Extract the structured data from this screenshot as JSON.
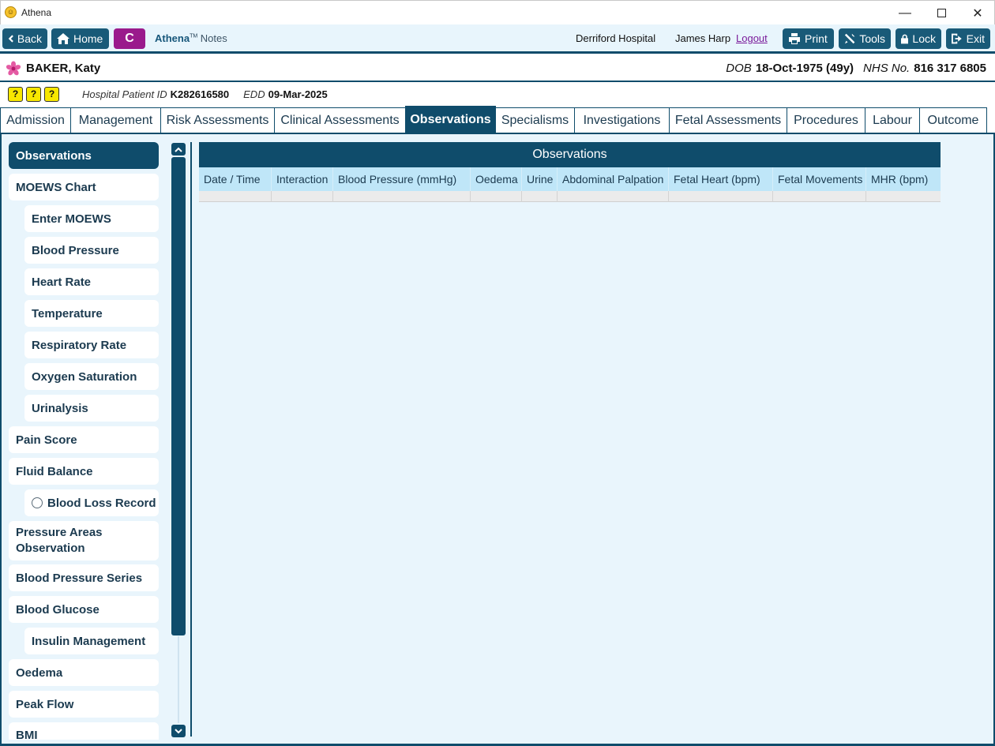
{
  "window": {
    "title": "Athena",
    "minimize": "—",
    "close": "✕"
  },
  "toolbar": {
    "back_label": "Back",
    "home_label": "Home",
    "c_label": "C",
    "brand_name": "Athena",
    "brand_tm": "TM",
    "brand_suffix": "Notes",
    "hospital": "Derriford Hospital",
    "user": "James Harp",
    "logout_label": "Logout",
    "print_label": "Print",
    "tools_label": "Tools",
    "lock_label": "Lock",
    "exit_label": "Exit"
  },
  "patient": {
    "surname": "BAKER,",
    "forename": " Katy",
    "dob_label": "DOB",
    "dob_value": "18-Oct-1975 (49y)",
    "nhs_label": "NHS No.",
    "nhs_value": "816 317 6805",
    "hospital_id_label": "Hospital Patient ID",
    "hospital_id_value": "K282616580",
    "edd_label": "EDD",
    "edd_value": "09-Mar-2025"
  },
  "alert_icons": [
    "?",
    "?",
    "?"
  ],
  "tabs": [
    {
      "label": "Admission"
    },
    {
      "label": "Management"
    },
    {
      "label": "Risk Assessments"
    },
    {
      "label": "Clinical Assessments"
    },
    {
      "label": "Observations"
    },
    {
      "label": "Specialisms"
    },
    {
      "label": "Investigations"
    },
    {
      "label": "Fetal Assessments"
    },
    {
      "label": "Procedures"
    },
    {
      "label": "Labour"
    },
    {
      "label": "Outcome"
    }
  ],
  "active_tab": "Observations",
  "sidebar": {
    "items": [
      {
        "label": "Observations"
      },
      {
        "label": "MOEWS Chart"
      },
      {
        "label": "Enter MOEWS"
      },
      {
        "label": "Blood Pressure"
      },
      {
        "label": "Heart Rate"
      },
      {
        "label": "Temperature"
      },
      {
        "label": "Respiratory Rate"
      },
      {
        "label": "Oxygen Saturation"
      },
      {
        "label": "Urinalysis"
      },
      {
        "label": "Pain Score"
      },
      {
        "label": "Fluid Balance"
      },
      {
        "label": "Blood Loss Record"
      },
      {
        "label": "Pressure Areas Observation"
      },
      {
        "label": "Blood Pressure Series"
      },
      {
        "label": "Blood Glucose"
      },
      {
        "label": "Insulin Management"
      },
      {
        "label": "Oedema"
      },
      {
        "label": "Peak Flow"
      },
      {
        "label": "BMI"
      }
    ]
  },
  "observations_table": {
    "title": "Observations",
    "columns": [
      "Date / Time",
      "Interaction",
      "Blood Pressure (mmHg)",
      "Oedema",
      "Urine",
      "Abdominal Palpation",
      "Fetal Heart (bpm)",
      "Fetal Movements",
      "MHR (bpm)"
    ],
    "rows": []
  },
  "colors": {
    "primary": "#0f4c6b",
    "button": "#195a78",
    "c_button": "#9a1a8c",
    "background": "#e9f5fc",
    "table_header": "#bfe6f8",
    "alert_yellow": "#f7e700",
    "logout": "#7a1a9a"
  }
}
